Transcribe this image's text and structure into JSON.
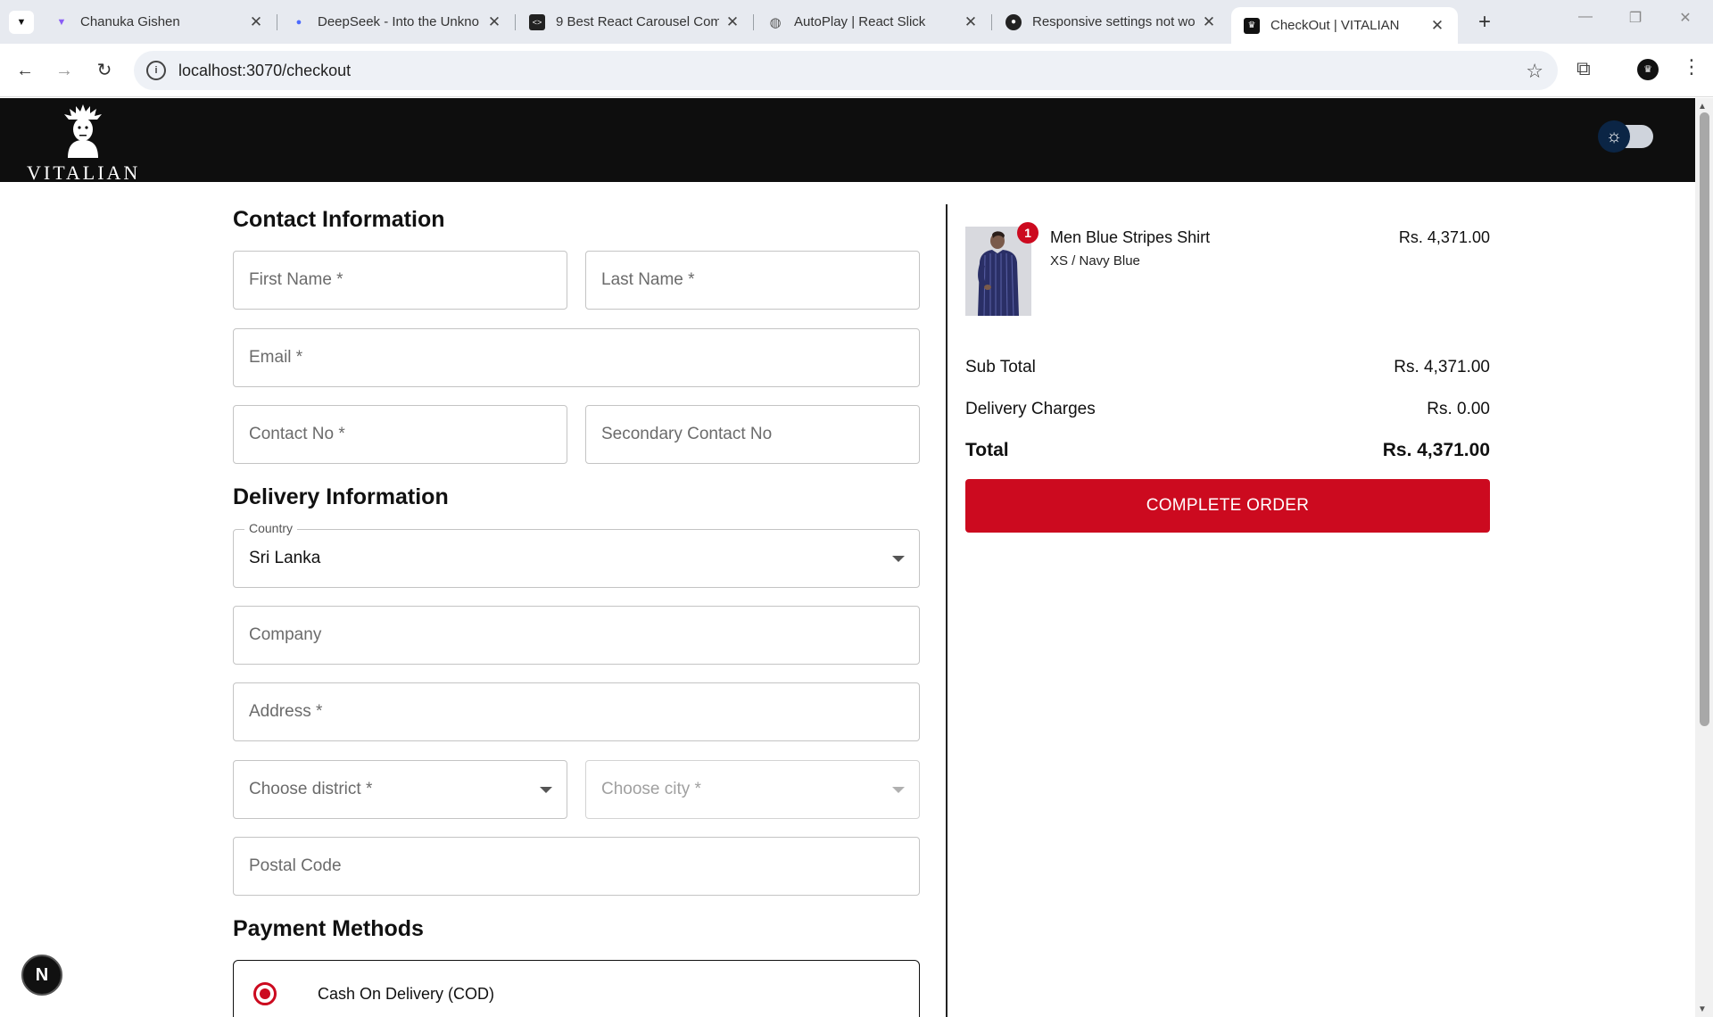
{
  "browser": {
    "tabs": [
      {
        "title": "Chanuka Gishen",
        "icon": "vite-icon"
      },
      {
        "title": "DeepSeek - Into the Unkno",
        "icon": "deepseek-icon"
      },
      {
        "title": "9 Best React Carousel Com",
        "icon": "code-icon"
      },
      {
        "title": "AutoPlay | React Slick",
        "icon": "globe-icon"
      },
      {
        "title": "Responsive settings not wo",
        "icon": "github-icon"
      },
      {
        "title": "CheckOut | VITALIAN",
        "icon": "vitalian-icon",
        "active": true
      }
    ],
    "close_glyph": "✕",
    "new_tab_glyph": "+",
    "url": "localhost:3070/checkout"
  },
  "header": {
    "brand": "VITALIAN",
    "theme_icon": "sun-icon"
  },
  "contact": {
    "title": "Contact Information",
    "first_name_ph": "First Name *",
    "last_name_ph": "Last Name *",
    "email_ph": "Email *",
    "contact_no_ph": "Contact No *",
    "secondary_contact_ph": "Secondary Contact No"
  },
  "delivery": {
    "title": "Delivery Information",
    "country_label": "Country",
    "country_value": "Sri Lanka",
    "company_ph": "Company",
    "address_ph": "Address *",
    "district_ph": "Choose district *",
    "city_ph": "Choose city *",
    "postal_ph": "Postal Code"
  },
  "payment": {
    "title": "Payment Methods",
    "selected_method": "Cash On Delivery (COD)"
  },
  "order": {
    "item": {
      "name": "Men Blue Stripes Shirt",
      "variant": "XS / Navy Blue",
      "price": "Rs. 4,371.00",
      "quantity": "1"
    },
    "sub_total_label": "Sub Total",
    "sub_total_value": "Rs. 4,371.00",
    "delivery_label": "Delivery Charges",
    "delivery_value": "Rs. 0.00",
    "total_label": "Total",
    "total_value": "Rs. 4,371.00",
    "complete_button": "COMPLETE ORDER"
  },
  "devtools_badge": "N",
  "colors": {
    "accent": "#cc0a1f",
    "header_bg": "#0e0e0e",
    "toggle_knob": "#0b2545"
  }
}
